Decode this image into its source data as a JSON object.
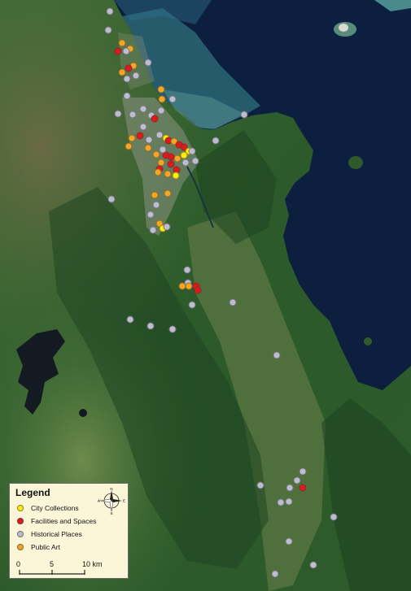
{
  "legend": {
    "title": "Legend",
    "items": [
      {
        "label": "City Collections",
        "color": "#ffee00"
      },
      {
        "label": "Facilities and Spaces",
        "color": "#e01a1a"
      },
      {
        "label": "Historical Places",
        "color": "#bdbdcf"
      },
      {
        "label": "Public Art",
        "color": "#f5a623"
      }
    ]
  },
  "scale_bar": {
    "labels": [
      "0",
      "5",
      "10 km"
    ]
  },
  "compass": {
    "n": "N",
    "s": "S",
    "e": "E",
    "w": "W",
    "icon": "north-arrow-icon"
  },
  "colors": {
    "sea": "#0d1f3f",
    "forest": "#2c5a2a",
    "urban": "#7c8a70",
    "water": "#141a22"
  }
}
